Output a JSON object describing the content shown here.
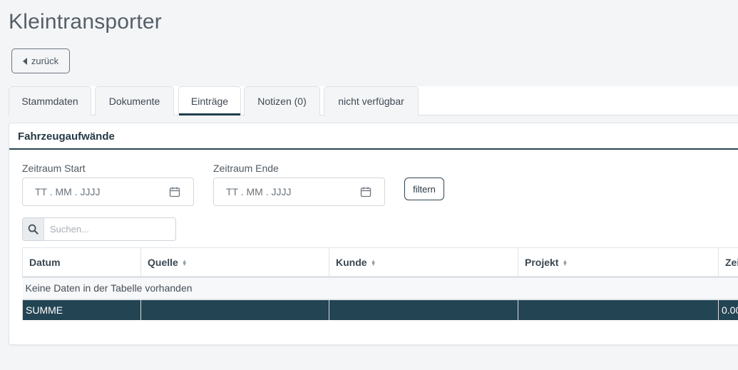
{
  "page": {
    "title": "Kleintransporter"
  },
  "back_button": {
    "label": "zurück"
  },
  "tabs": [
    {
      "label": "Stammdaten",
      "active": false
    },
    {
      "label": "Dokumente",
      "active": false
    },
    {
      "label": "Einträge",
      "active": true
    },
    {
      "label": "Notizen (0)",
      "active": false
    },
    {
      "label": "nicht verfügbar",
      "active": false
    }
  ],
  "card": {
    "title": "Fahrzeugaufwände",
    "filters": {
      "start": {
        "label": "Zeitraum Start",
        "placeholder": "TT . MM . JJJJ",
        "value": ""
      },
      "end": {
        "label": "Zeitraum Ende",
        "placeholder": "TT . MM . JJJJ",
        "value": ""
      },
      "button_label": "filtern"
    },
    "search": {
      "placeholder": "Suchen...",
      "value": ""
    },
    "table": {
      "columns": [
        "Datum",
        "Quelle",
        "Kunde",
        "Projekt",
        "Zei"
      ],
      "empty_message": "Keine Daten in der Tabelle vorhanden",
      "sum_row": [
        "SUMME",
        "",
        "",
        "",
        "0.00"
      ]
    }
  },
  "colors": {
    "accent": "#234453",
    "active_tab_underline": "#1f3f4e",
    "background": "#f4f5f7"
  },
  "icons": {
    "back": "caret-left-icon",
    "calendar": "calendar-icon",
    "search": "search-icon",
    "sort": "sort-icon"
  }
}
